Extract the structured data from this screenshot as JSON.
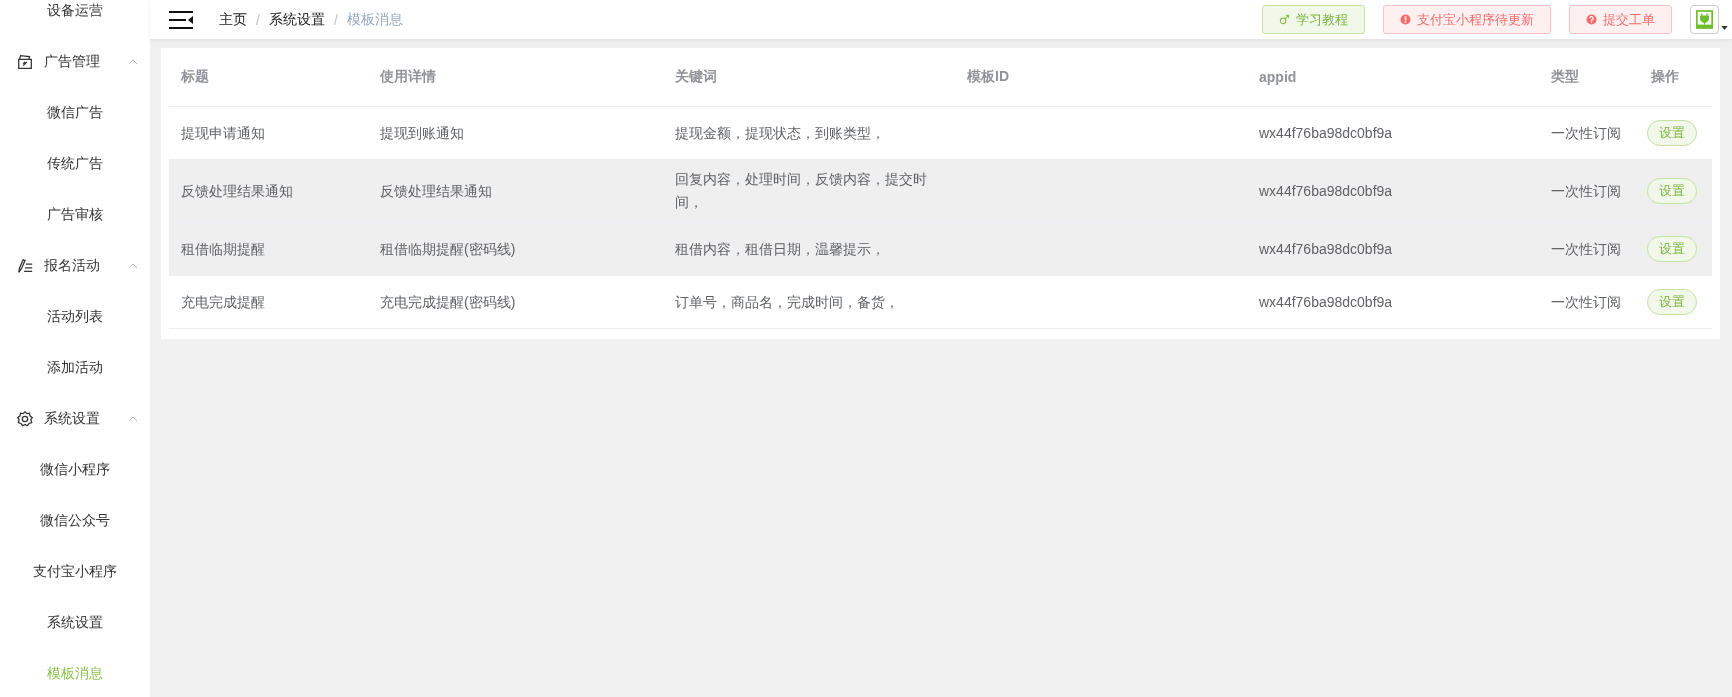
{
  "sidebar": {
    "items": [
      {
        "kind": "item",
        "label": "设备运营",
        "selected": false
      },
      {
        "kind": "group",
        "label": "广告管理",
        "expanded": true,
        "children": [
          {
            "label": "微信广告",
            "selected": false
          },
          {
            "label": "传统广告",
            "selected": false
          },
          {
            "label": "广告审核",
            "selected": false
          }
        ]
      },
      {
        "kind": "group",
        "label": "报名活动",
        "expanded": true,
        "children": [
          {
            "label": "活动列表",
            "selected": false
          },
          {
            "label": "添加活动",
            "selected": false
          }
        ]
      },
      {
        "kind": "group",
        "label": "系统设置",
        "expanded": true,
        "children": [
          {
            "label": "微信小程序",
            "selected": false
          },
          {
            "label": "微信公众号",
            "selected": false
          },
          {
            "label": "支付宝小程序",
            "selected": false
          },
          {
            "label": "系统设置",
            "selected": false
          },
          {
            "label": "模板消息",
            "selected": true
          }
        ]
      }
    ]
  },
  "breadcrumb": [
    {
      "label": "主页"
    },
    {
      "separator": "/",
      "label": "系统设置"
    },
    {
      "separator": "/",
      "label": "模板消息"
    }
  ],
  "header_buttons": [
    {
      "kind": "tutorial",
      "label": "学习教程"
    },
    {
      "kind": "warning",
      "label": "支付宝小程序待更新"
    },
    {
      "kind": "help",
      "label": "提交工单"
    }
  ],
  "table": {
    "columns": [
      "标题",
      "使用详情",
      "关键词",
      "模板ID",
      "appid",
      "类型",
      "操作"
    ],
    "rows": [
      {
        "title": "提现申请通知",
        "detail": "提现到账通知",
        "keywords": "提现金额，提现状态，到账类型，",
        "appid": "wx44f76ba98dc0bf9a",
        "type": "一次性订阅",
        "action": "设置",
        "highlighted": false
      },
      {
        "title": "反馈处理结果通知",
        "detail": "反馈处理结果通知",
        "keywords": "回复内容，处理时间，反馈内容，提交时间，",
        "appid": "wx44f76ba98dc0bf9a",
        "type": "一次性订阅",
        "action": "设置",
        "highlighted": true
      },
      {
        "title": "租借临期提醒",
        "detail": "租借临期提醒(密码线)",
        "keywords": "租借内容，租借日期，温馨提示，",
        "appid": "wx44f76ba98dc0bf9a",
        "type": "一次性订阅",
        "action": "设置",
        "highlighted": true
      },
      {
        "title": "充电完成提醒",
        "detail": "充电完成提醒(密码线)",
        "keywords": "订单号，商品名，完成时间，备货，",
        "appid": "wx44f76ba98dc0bf9a",
        "type": "一次性订阅",
        "action": "设置",
        "highlighted": false
      }
    ]
  }
}
